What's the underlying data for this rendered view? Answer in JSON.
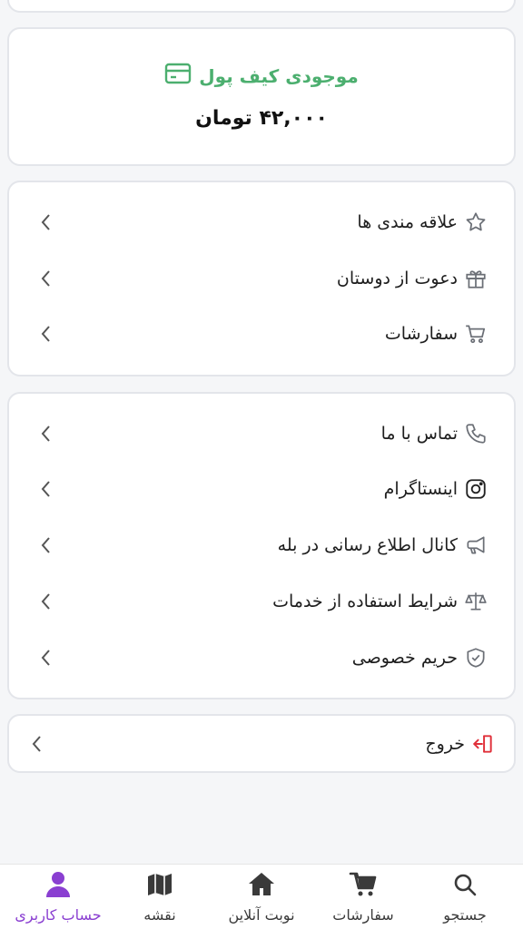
{
  "wallet": {
    "title": "موجودی کیف پول",
    "amount": "۴۲,۰۰۰ تومان"
  },
  "menu_group_1": [
    {
      "label": "علاقه مندی ها",
      "icon": "star-icon"
    },
    {
      "label": "دعوت از دوستان",
      "icon": "gift-icon"
    },
    {
      "label": "سفارشات",
      "icon": "cart-icon"
    }
  ],
  "menu_group_2": [
    {
      "label": "تماس با ما",
      "icon": "phone-icon"
    },
    {
      "label": "اینستاگرام",
      "icon": "instagram-icon"
    },
    {
      "label": "کانال اطلاع رسانی در بله",
      "icon": "megaphone-icon"
    },
    {
      "label": "شرایط استفاده از خدمات",
      "icon": "scale-icon"
    },
    {
      "label": "حریم خصوصی",
      "icon": "shield-check-icon"
    }
  ],
  "logout": {
    "label": "خروج",
    "icon": "logout-icon"
  },
  "bottom_nav": [
    {
      "label": "جستجو",
      "icon": "search-icon"
    },
    {
      "label": "سفارشات",
      "icon": "cart-icon"
    },
    {
      "label": "نوبت آنلاین",
      "icon": "home-icon"
    },
    {
      "label": "نقشه",
      "icon": "map-icon"
    },
    {
      "label": "حساب کاربری",
      "icon": "user-icon",
      "active": true
    }
  ],
  "colors": {
    "wallet_green": "#4caf6f",
    "active_purple": "#8a3fd1",
    "logout_red": "#e0303a",
    "icon_gray": "#6b6f76"
  }
}
